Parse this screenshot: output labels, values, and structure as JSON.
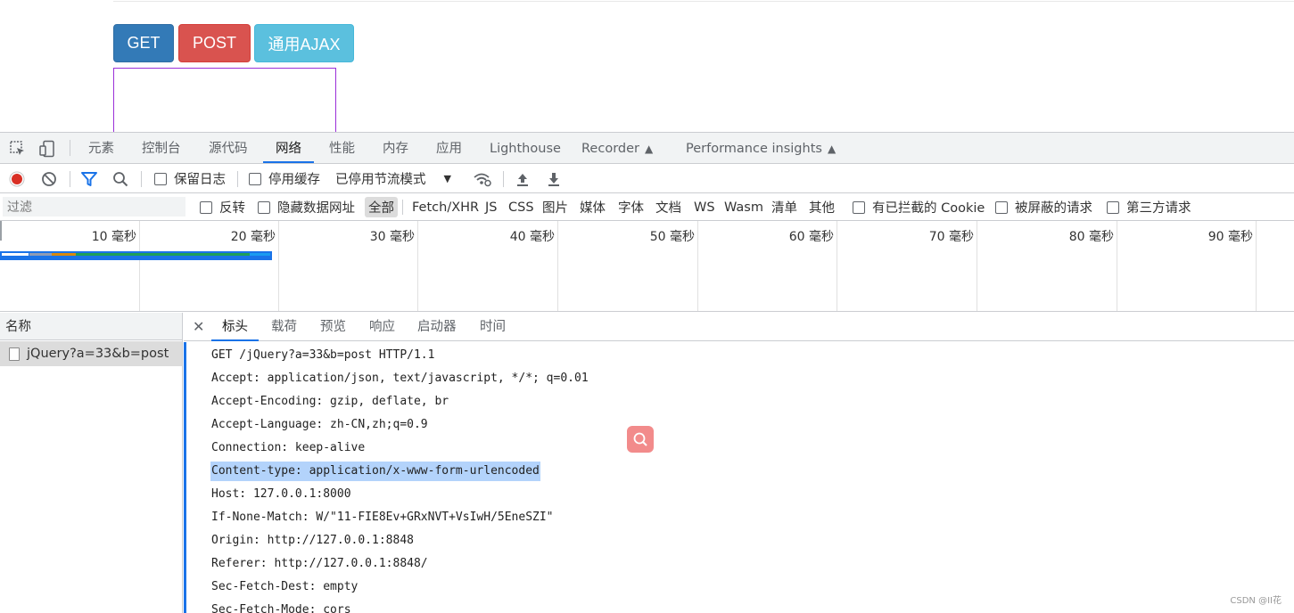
{
  "page": {
    "buttons": {
      "get": "GET",
      "post": "POST",
      "ajax": "通用AJAX"
    }
  },
  "devtools": {
    "panel_tabs": [
      "元素",
      "控制台",
      "源代码",
      "网络",
      "性能",
      "内存",
      "应用",
      "Lighthouse",
      "Recorder",
      "Performance insights"
    ],
    "active_panel": "网络",
    "toolbar": {
      "preserve_log": "保留日志",
      "disable_cache": "停用缓存",
      "throttling": "已停用节流模式"
    },
    "filter": {
      "placeholder": "过滤",
      "invert": "反转",
      "hide_data_urls": "隐藏数据网址",
      "types": [
        "全部",
        "Fetch/XHR",
        "JS",
        "CSS",
        "图片",
        "媒体",
        "字体",
        "文档",
        "WS",
        "Wasm",
        "清单",
        "其他"
      ],
      "active_type": "全部",
      "blocked_cookies": "有已拦截的 Cookie",
      "blocked_requests": "被屏蔽的请求",
      "third_party": "第三方请求"
    },
    "overview_ticks": [
      "10 毫秒",
      "20 毫秒",
      "30 毫秒",
      "40 毫秒",
      "50 毫秒",
      "60 毫秒",
      "70 毫秒",
      "80 毫秒",
      "90 毫秒"
    ],
    "request_list": {
      "header": "名称",
      "items": [
        "jQuery?a=33&b=post"
      ]
    },
    "detail_tabs": [
      "标头",
      "载荷",
      "预览",
      "响应",
      "启动器",
      "时间"
    ],
    "active_detail_tab": "标头",
    "request_headers": [
      "GET /jQuery?a=33&b=post HTTP/1.1",
      "Accept: application/json, text/javascript, */*; q=0.01",
      "Accept-Encoding: gzip, deflate, br",
      "Accept-Language: zh-CN,zh;q=0.9",
      "Connection: keep-alive",
      "Content-type: application/x-www-form-urlencoded",
      "Host: 127.0.0.1:8000",
      "If-None-Match: W/\"11-FIE8Ev+GRxNVT+VsIwH/5EneSZI\"",
      "Origin: http://127.0.0.1:8848",
      "Referer: http://127.0.0.1:8848/",
      "Sec-Fetch-Dest: empty",
      "Sec-Fetch-Mode: cors"
    ],
    "selected_header_index": 5
  },
  "watermark": "CSDN @II花",
  "colors": {
    "get_button": "#337ab7",
    "post_button": "#d9534f",
    "ajax_button": "#5bc0de",
    "accent": "#1a73e8",
    "record": "#d93025"
  }
}
